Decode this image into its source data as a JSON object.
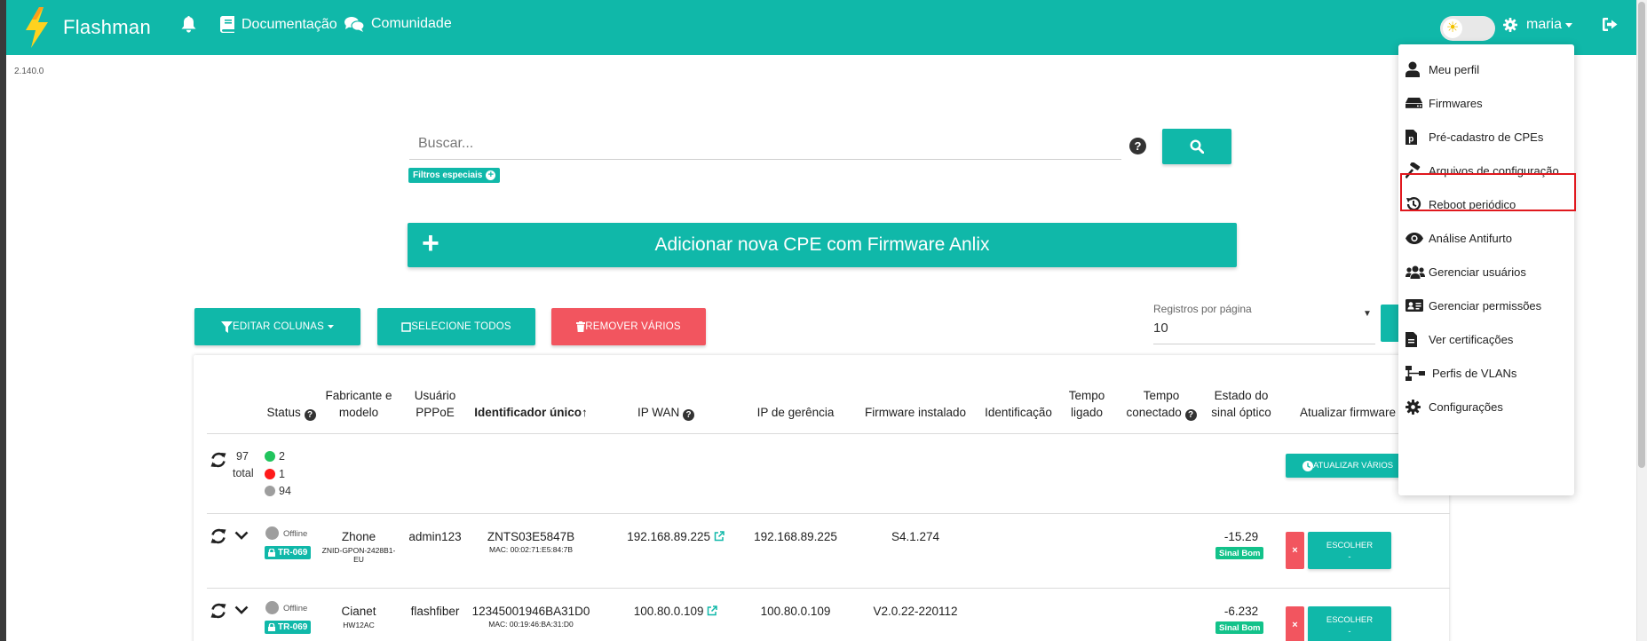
{
  "app": {
    "brand": "Flashman",
    "version": "2.140.0",
    "colors": {
      "primary": "#10b8a9",
      "danger": "#f2555f",
      "online": "#21c45d",
      "offline_red": "#ff1a1a",
      "offline_grey": "#9e9e9e",
      "signal_good": "#13c28a"
    }
  },
  "navbar": {
    "bell_icon": "bell-icon",
    "docs_label": "Documentação",
    "community_label": "Comunidade",
    "user_label": "maria"
  },
  "search": {
    "placeholder": "Buscar...",
    "filter_chip": "Filtros especiais"
  },
  "add_cpe_label": "Adicionar nova CPE com Firmware Anlix",
  "actions": {
    "edit_columns": "EDITAR COLUNAS",
    "select_all": "SELECIONE TODOS",
    "remove_many": "REMOVER VÁRIOS"
  },
  "per_page": {
    "label": "Registros por página",
    "value": "10"
  },
  "table": {
    "headers": {
      "status": "Status",
      "maker_line1": "Fabricante e",
      "maker_line2": "modelo",
      "pppoe_line1": "Usuário",
      "pppoe_line2": "PPPoE",
      "unique_id": "Identificador único↑",
      "ip_wan": "IP WAN",
      "ip_mgmt": "IP de gerência",
      "firmware": "Firmware instalado",
      "identification": "Identificação",
      "uptime_line1": "Tempo",
      "uptime_line2": "ligado",
      "conn_line1": "Tempo",
      "conn_line2": "conectado",
      "optic_line1": "Estado do",
      "optic_line2": "sinal óptico",
      "update_fw": "Atualizar firmware"
    },
    "summary": {
      "total_count": "97",
      "total_label": "total",
      "online": "2",
      "red": "1",
      "grey": "94",
      "update_many": "ATUALIZAR VÁRIOS"
    },
    "rows": [
      {
        "status": "Offline",
        "protocol": "TR-069",
        "maker": "Zhone",
        "model": "ZNID-GPON-2428B1-EU",
        "pppoe": "admin123",
        "unique_id": "ZNTS03E5847B",
        "mac": "MAC: 00:02:71:E5:84:7B",
        "ip_wan": "192.168.89.225",
        "ip_mgmt": "192.168.89.225",
        "firmware": "S4.1.274",
        "signal": "-15.29",
        "signal_badge": "Sinal Bom",
        "choose_label": "ESCOLHER",
        "choose_sub": "-"
      },
      {
        "status": "Offline",
        "protocol": "TR-069",
        "maker": "Cianet",
        "model": "HW12AC",
        "pppoe": "flashfiber",
        "unique_id": "12345001946BA31D0",
        "mac": "MAC: 00:19:46:BA:31:D0",
        "ip_wan": "100.80.0.109",
        "ip_mgmt": "100.80.0.109",
        "firmware": "V2.0.22-220112",
        "signal": "-6.232",
        "signal_badge": "Sinal Bom",
        "choose_label": "ESCOLHER",
        "choose_sub": "-"
      }
    ]
  },
  "user_dropdown": {
    "items": [
      {
        "label": "Meu perfil",
        "icon": "user-icon"
      },
      {
        "label": "Firmwares",
        "icon": "router-icon"
      },
      {
        "label": "Pré-cadastro de CPEs",
        "icon": "p-file-icon"
      },
      {
        "label": "Arquivos de configuração",
        "icon": "hammer-icon"
      },
      {
        "label": "Reboot periódico",
        "icon": "history-icon"
      },
      {
        "label": "Análise Antifurto",
        "icon": "eye-icon"
      },
      {
        "label": "Gerenciar usuários",
        "icon": "users-icon"
      },
      {
        "label": "Gerenciar permissões",
        "icon": "id-card-icon"
      },
      {
        "label": "Ver certificações",
        "icon": "file-icon"
      },
      {
        "label": "Perfis de VLANs",
        "icon": "network-icon"
      },
      {
        "label": "Configurações",
        "icon": "gear-icon"
      }
    ]
  }
}
